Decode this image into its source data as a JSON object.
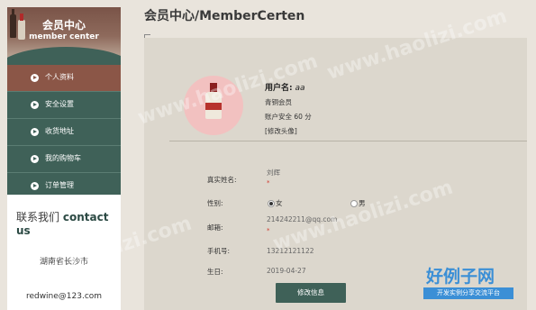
{
  "sidebar": {
    "title_cn": "会员中心",
    "title_en": "member center",
    "menu": [
      {
        "label": "个人资料",
        "active": true
      },
      {
        "label": "安全设置"
      },
      {
        "label": "收货地址"
      },
      {
        "label": "我的购物车"
      },
      {
        "label": "订单管理"
      }
    ],
    "contact_cn": "联系我们",
    "contact_en": "contact us",
    "address": "湖南省长沙市",
    "email": "redwine@123.com"
  },
  "main": {
    "title": "会员中心/MemberCerten",
    "profile": {
      "username_label": "用户名:",
      "username_value": "aa",
      "level": "青铜会员",
      "security": "账户安全 60 分",
      "edit_avatar": "[修改头像]"
    },
    "form": {
      "realname_label": "真实姓名:",
      "realname_value": "刘辉",
      "gender_label": "性别:",
      "gender_female": "女",
      "gender_male": "男",
      "gender_selected": "女",
      "email_label": "邮箱:",
      "email_value": "214242211@qq.com",
      "phone_label": "手机号:",
      "phone_value": "13212121122",
      "birthday_label": "生日:",
      "birthday_value": "2019-04-27",
      "required_mark": "*",
      "submit_label": "修改信息"
    }
  },
  "watermark": {
    "text": "www.haolizi.com",
    "logo_cn": "好例子网",
    "logo_sub": "开发实例分享交流平台"
  },
  "colors": {
    "sidebar_green": "#3f6158",
    "active_brown": "#8b5647",
    "panel_bg": "#dcd7cd",
    "page_bg": "#e9e4dc",
    "required_red": "#d13a2f",
    "logo_blue": "#3b8fd6"
  }
}
